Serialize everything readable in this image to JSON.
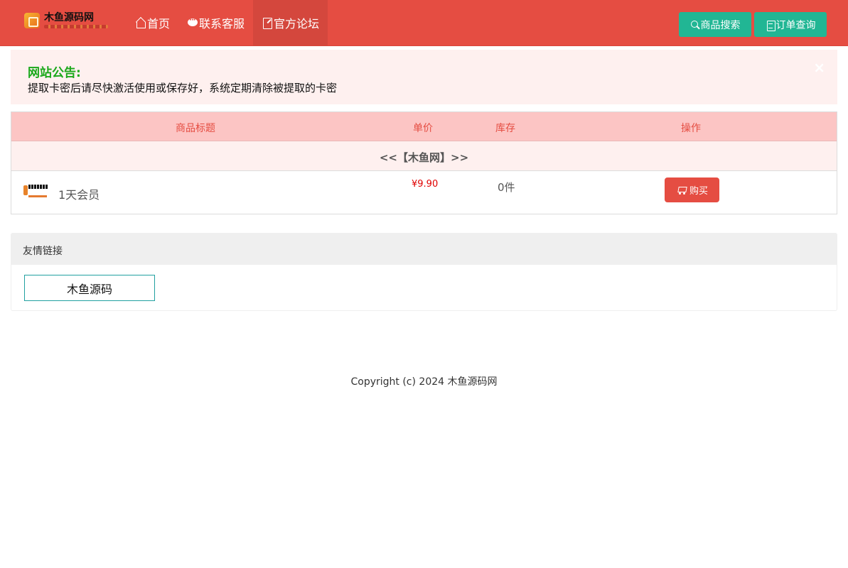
{
  "site": {
    "logo_text": "木鱼源码网"
  },
  "nav": {
    "items": [
      {
        "label": "首页",
        "icon": "home-icon"
      },
      {
        "label": "联系客服",
        "icon": "chat-icon"
      },
      {
        "label": "官方论坛",
        "icon": "forum-icon"
      }
    ],
    "search_button": "商品搜索",
    "order_button": "订单查询"
  },
  "notice": {
    "title": "网站公告:",
    "text": "提取卡密后请尽快激活使用或保存好，系统定期清除被提取的卡密",
    "close": "×"
  },
  "table": {
    "headers": [
      "商品标题",
      "单价",
      "库存",
      "操作"
    ],
    "group": "<<【木鱼网】>>",
    "rows": [
      {
        "name": "1天会员",
        "price": "¥9.90",
        "stock": "0件",
        "action": "购买"
      }
    ]
  },
  "links": {
    "title": "友情链接",
    "items": [
      "木鱼源码"
    ]
  },
  "footer": {
    "copyright": "Copyright (c) 2024 木鱼源码网"
  },
  "colors": {
    "brand": "#e54d42",
    "accent": "#21b694",
    "notice_title": "#1aa81a",
    "price": "#e00000"
  }
}
